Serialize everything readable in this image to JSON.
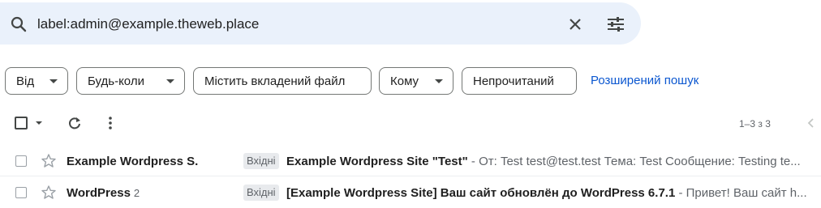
{
  "search": {
    "query": "label:admin@example.theweb.place"
  },
  "filters": {
    "chips": [
      "Від",
      "Будь-коли",
      "Містить вкладений файл",
      "Кому",
      "Непрочитаний"
    ],
    "advanced_link": "Розширений пошук"
  },
  "toolbar": {
    "pager": "1–3 з 3"
  },
  "messages": [
    {
      "sender": "Example Wordpress S.",
      "thread_count": "",
      "label": "Вхідні",
      "subject": "Example Wordpress Site \"Test\"",
      "snippet": " - От: Test test@test.test Тема: Test Сообщение: Testing te..."
    },
    {
      "sender": "WordPress",
      "thread_count": "2",
      "label": "Вхідні",
      "subject": "[Example Wordpress Site] Ваш сайт обновлён до WordPress 6.7.1",
      "snippet": " - Привет! Ваш сайт h..."
    }
  ]
}
